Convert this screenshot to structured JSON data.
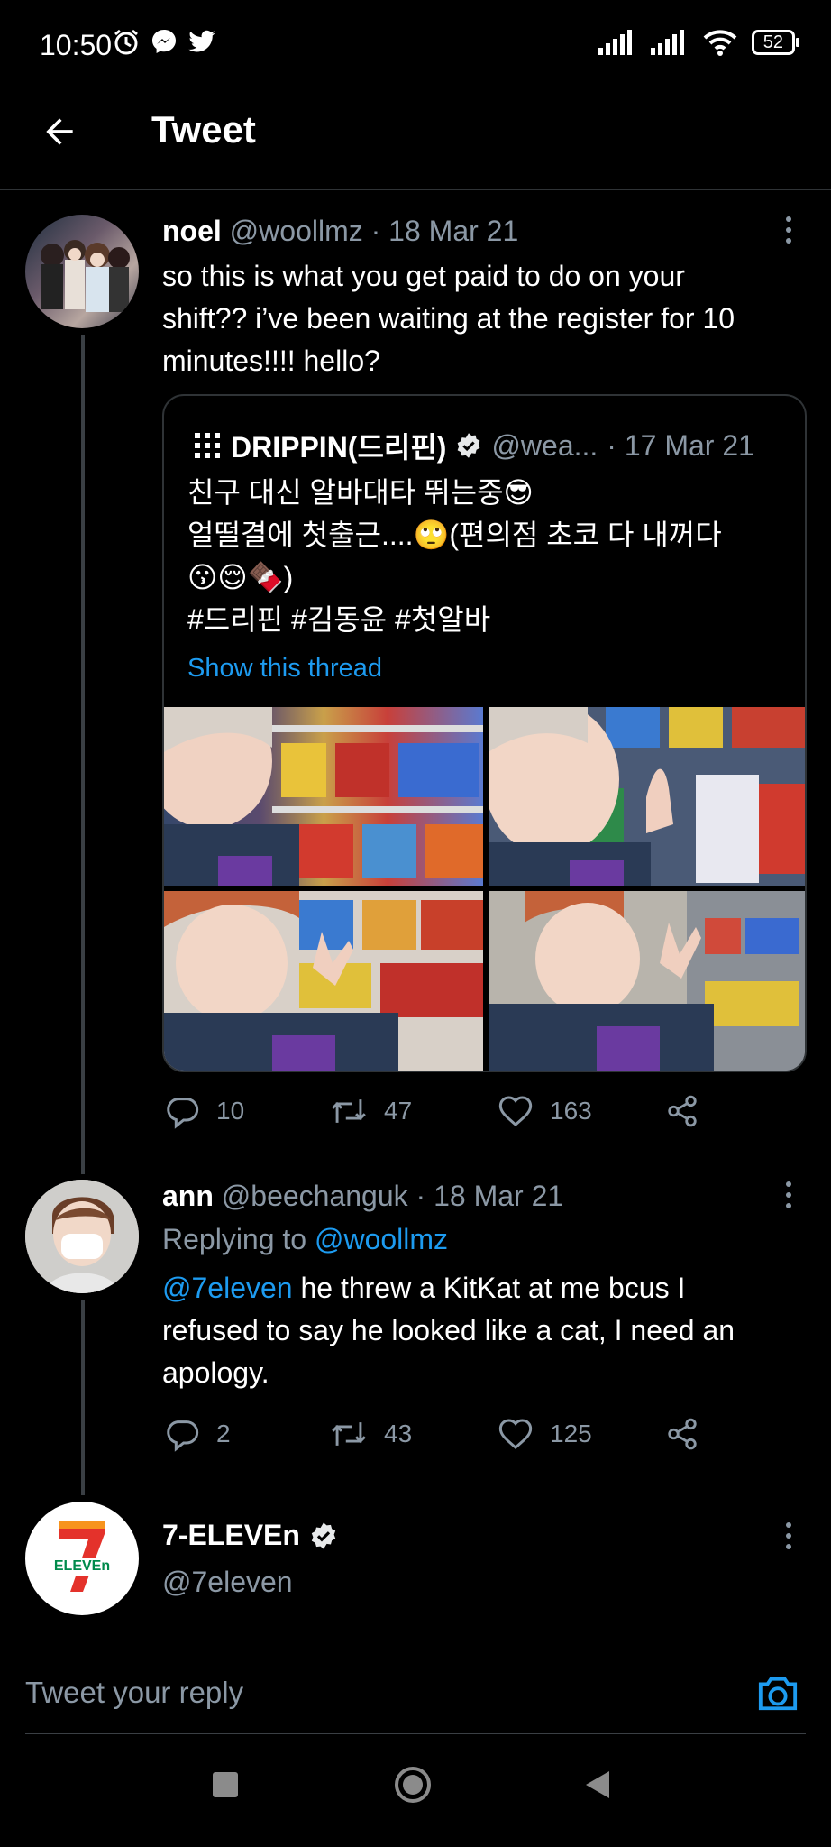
{
  "status": {
    "time": "10:50",
    "battery": "52"
  },
  "header": {
    "title": "Tweet"
  },
  "main_tweet": {
    "name": "noel",
    "handle": "@woollmz",
    "date": "· 18 Mar 21",
    "text_line1": "so this is what you get paid to do on your",
    "text_line2": "shift?? i’ve been waiting at the register for 10",
    "text_line3": "minutes!!!! hello?",
    "quote": {
      "name": "DRIPPIN(드리핀)",
      "handle": "@wea...",
      "date": "· 17 Mar 21",
      "line1": "친구 대신 알바대타 뛰는중😎",
      "line2": "얼떨결에 첫출근....🙄(편의점 초코 다 내꺼다",
      "line3": "😗😌🍫)",
      "line4": "#드리핀 #김동윤 #첫알바",
      "show_thread": "Show this thread"
    },
    "stats": {
      "replies": "10",
      "retweets": "47",
      "likes": "163"
    }
  },
  "reply_tweet": {
    "name": "ann",
    "handle": "@beechanguk",
    "date": "· 18 Mar 21",
    "replying_prefix": "Replying to",
    "replying_handle": "@woollmz",
    "mention": "@7eleven",
    "text_part1": " he threw a KitKat at me bcus I",
    "text_line2": "refused to say he looked like a cat, I need an",
    "text_line3": "apology.",
    "stats": {
      "replies": "2",
      "retweets": "43",
      "likes": "125"
    }
  },
  "current_user": {
    "name": "7-ELEVEn",
    "handle": "@7eleven",
    "logo_text": "ELEVEn"
  },
  "composer": {
    "placeholder": "Tweet your reply"
  },
  "colors": {
    "accent": "#1d9bf0",
    "background": "#000000",
    "muted": "#8b98a5",
    "divider": "#2f3336"
  }
}
